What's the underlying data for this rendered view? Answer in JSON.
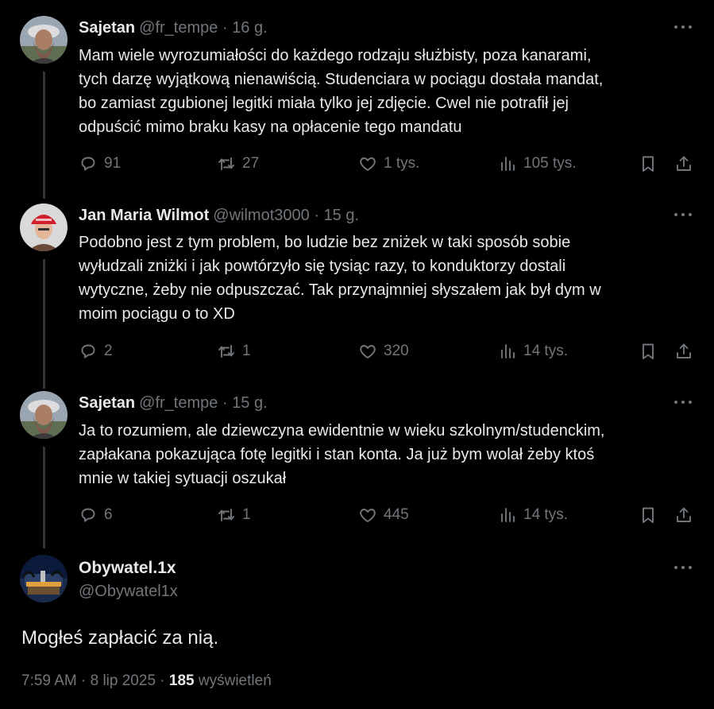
{
  "thread": [
    {
      "name": "Sajetan",
      "handle": "@fr_tempe",
      "sep": "·",
      "time": "16 g.",
      "text_lines": [
        "Mam wiele wyrozumiałości do każdego rodzaju służbisty, poza kanarami,",
        "tych darzę wyjątkową nienawiścią. Studenciara w pociągu dostała mandat,",
        "bo zamiast zgubionej legitki miała tylko jej zdjęcie. Cwel nie potrafił jej",
        "odpuścić mimo braku kasy na opłacenie tego mandatu"
      ],
      "replies": "91",
      "reposts": "27",
      "likes": "1 tys.",
      "views": "105 tys."
    },
    {
      "name": "Jan Maria Wilmot",
      "handle": "@wilmot3000",
      "sep": "·",
      "time": "15 g.",
      "text_lines": [
        "Podobno jest z tym problem, bo ludzie bez zniżek w taki sposób sobie",
        "wyłudzali zniżki i jak powtórzyło się tysiąc razy, to konduktorzy dostali",
        "wytyczne, żeby nie odpuszczać. Tak przynajmniej słyszałem jak był dym w",
        "moim pociągu o to XD"
      ],
      "replies": "2",
      "reposts": "1",
      "likes": "320",
      "views": "14 tys."
    },
    {
      "name": "Sajetan",
      "handle": "@fr_tempe",
      "sep": "·",
      "time": "15 g.",
      "text_lines": [
        "Ja to rozumiem, ale dziewczyna ewidentnie w wieku szkolnym/studenckim,",
        "zapłakana pokazująca fotę legitki i stan konta. Ja już bym wolał żeby ktoś",
        "mnie w takiej sytuacji oszukał"
      ],
      "replies": "6",
      "reposts": "1",
      "likes": "445",
      "views": "14 tys."
    }
  ],
  "main": {
    "name": "Obywatel.1x",
    "handle": "@Obywatel1x",
    "text": "Mogłeś zapłacić za nią.",
    "time": "7:59 AM",
    "sep1": "·",
    "date": "8 lip 2025",
    "sep2": "·",
    "views_count": "185",
    "views_label": "wyświetleń"
  },
  "colors": {
    "background": "#000000",
    "text": "#e7e9ea",
    "muted": "#71767b",
    "thread_line": "#333639"
  },
  "icons": [
    "reply-icon",
    "repost-icon",
    "like-icon",
    "views-icon",
    "bookmark-icon",
    "share-icon",
    "more-icon"
  ]
}
